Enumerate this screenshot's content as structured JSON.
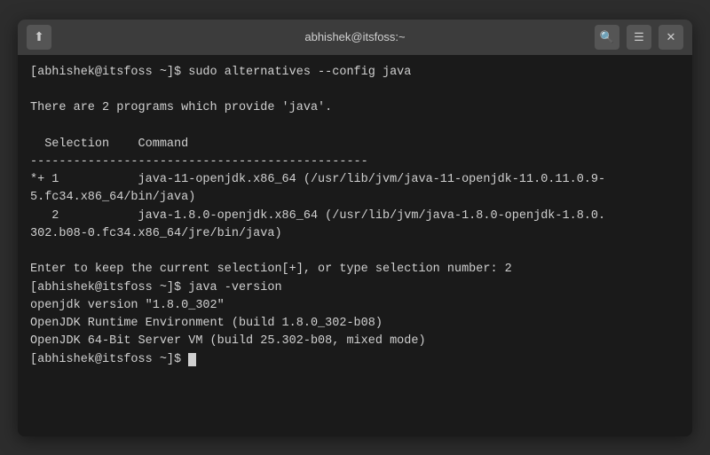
{
  "window": {
    "title": "abhishek@itsfoss:~",
    "icon": "⬆",
    "search_icon": "🔍",
    "menu_icon": "☰",
    "close_icon": "✕"
  },
  "terminal": {
    "lines": [
      "[abhishek@itsfoss ~]$ sudo alternatives --config java",
      "",
      "There are 2 programs which provide 'java'.",
      "",
      "  Selection    Command",
      "-----------------------------------------------",
      "*+ 1           java-11-openjdk.x86_64 (/usr/lib/jvm/java-11-openjdk-11.0.11.0.9-",
      "5.fc34.x86_64/bin/java)",
      "   2           java-1.8.0-openjdk.x86_64 (/usr/lib/jvm/java-1.8.0-openjdk-1.8.0.",
      "302.b08-0.fc34.x86_64/jre/bin/java)",
      "",
      "Enter to keep the current selection[+], or type selection number: 2",
      "[abhishek@itsfoss ~]$ java -version",
      "openjdk version \"1.8.0_302\"",
      "OpenJDK Runtime Environment (build 1.8.0_302-b08)",
      "OpenJDK 64-Bit Server VM (build 25.302-b08, mixed mode)",
      "[abhishek@itsfoss ~]$ "
    ]
  }
}
